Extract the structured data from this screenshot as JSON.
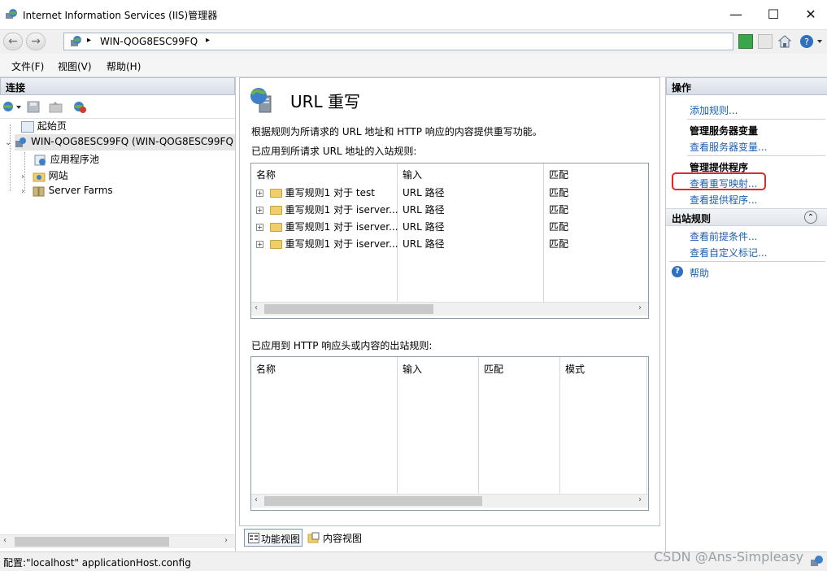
{
  "window": {
    "title": "Internet Information Services (IIS)管理器",
    "minimize": "—",
    "maximize": "☐",
    "close": "✕"
  },
  "address": {
    "path": "WIN-QOG8ESC99FQ",
    "sep": "▸",
    "back": "←",
    "forward": "→"
  },
  "menu": [
    "文件(F)",
    "视图(V)",
    "帮助(H)"
  ],
  "left": {
    "title": "连接",
    "tree": [
      {
        "label": "起始页"
      },
      {
        "label": "WIN-QOG8ESC99FQ (WIN-QOG8ESC99FQ"
      },
      {
        "label": "应用程序池"
      },
      {
        "label": "网站"
      },
      {
        "label": "Server Farms"
      }
    ]
  },
  "main": {
    "title": "URL 重写",
    "description": "根据规则为所请求的 URL 地址和 HTTP 响应的内容提供重写功能。",
    "inbound_label": "已应用到所请求 URL 地址的入站规则:",
    "inbound_columns": [
      "名称",
      "输入",
      "匹配"
    ],
    "inbound_rules": [
      {
        "name": "重写规则1 对于 test",
        "input": "URL 路径",
        "match": "匹配"
      },
      {
        "name": "重写规则1 对于 iserver...",
        "input": "URL 路径",
        "match": "匹配"
      },
      {
        "name": "重写规则1 对于 iserver...",
        "input": "URL 路径",
        "match": "匹配"
      },
      {
        "name": "重写规则1 对于 iserver...",
        "input": "URL 路径",
        "match": "匹配"
      }
    ],
    "outbound_label": "已应用到 HTTP 响应头或内容的出站规则:",
    "outbound_columns": [
      "名称",
      "输入",
      "匹配",
      "模式"
    ],
    "view_tabs": [
      "功能视图",
      "内容视图"
    ]
  },
  "right": {
    "title": "操作",
    "add_rule": "添加规则...",
    "server_vars_head": "管理服务器变量",
    "view_server_vars": "查看服务器变量...",
    "providers_head": "管理提供程序",
    "view_rewrite_maps": "查看重写映射...",
    "view_providers": "查看提供程序...",
    "outbound_head": "出站规则",
    "collapse": "⌃",
    "view_preconditions": "查看前提条件...",
    "view_custom_tags": "查看自定义标记...",
    "help": "帮助",
    "help_glyph": "?"
  },
  "status": {
    "text": "配置:\"localhost\" applicationHost.config",
    "watermark": "CSDN @Ans-Simpleasy"
  },
  "colors": {
    "link": "#1a5fb4",
    "highlight_box": "#e8262a"
  }
}
